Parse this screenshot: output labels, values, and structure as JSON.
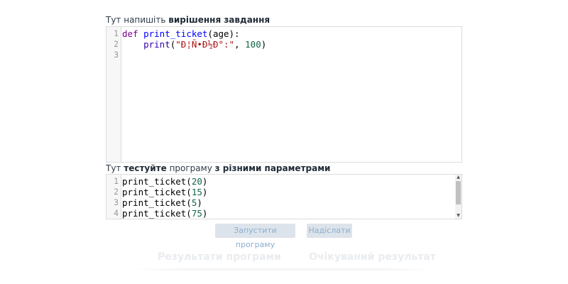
{
  "solution": {
    "label_plain": "Тут напишіть ",
    "label_bold": "вирішення завдання",
    "lines": [
      {
        "num": "1"
      },
      {
        "num": "2"
      },
      {
        "num": "3"
      }
    ],
    "code": {
      "kw_def": "def",
      "fn_name": "print_ticket",
      "params": "(age):",
      "indent": "    ",
      "builtin_print": "print",
      "open_paren": "(",
      "string_literal": "\"Ð¦Ñ•Ð½Ð°:\"",
      "comma": ", ",
      "number": "100",
      "close_paren": ")"
    }
  },
  "test": {
    "label_plain1": "Тут ",
    "label_bold1": "тестуйте",
    "label_plain2": " програму ",
    "label_bold2": "з різними параметрами",
    "lines": [
      {
        "num": "1",
        "call": "print_ticket(",
        "arg": "20",
        "close": ")"
      },
      {
        "num": "2",
        "call": "print_ticket(",
        "arg": "15",
        "close": ")"
      },
      {
        "num": "3",
        "call": "print_ticket(",
        "arg": "5",
        "close": ")"
      },
      {
        "num": "4",
        "call": "print_ticket(",
        "arg": "75",
        "close": ")"
      }
    ]
  },
  "buttons": {
    "run_label": "Запустити програму",
    "send_label": "Надіслати"
  },
  "results": {
    "program_output_title": "Результати програми",
    "expected_title": "Очікуваний результат"
  },
  "icons": {
    "scroll_up": "▲",
    "scroll_down": "▼"
  }
}
